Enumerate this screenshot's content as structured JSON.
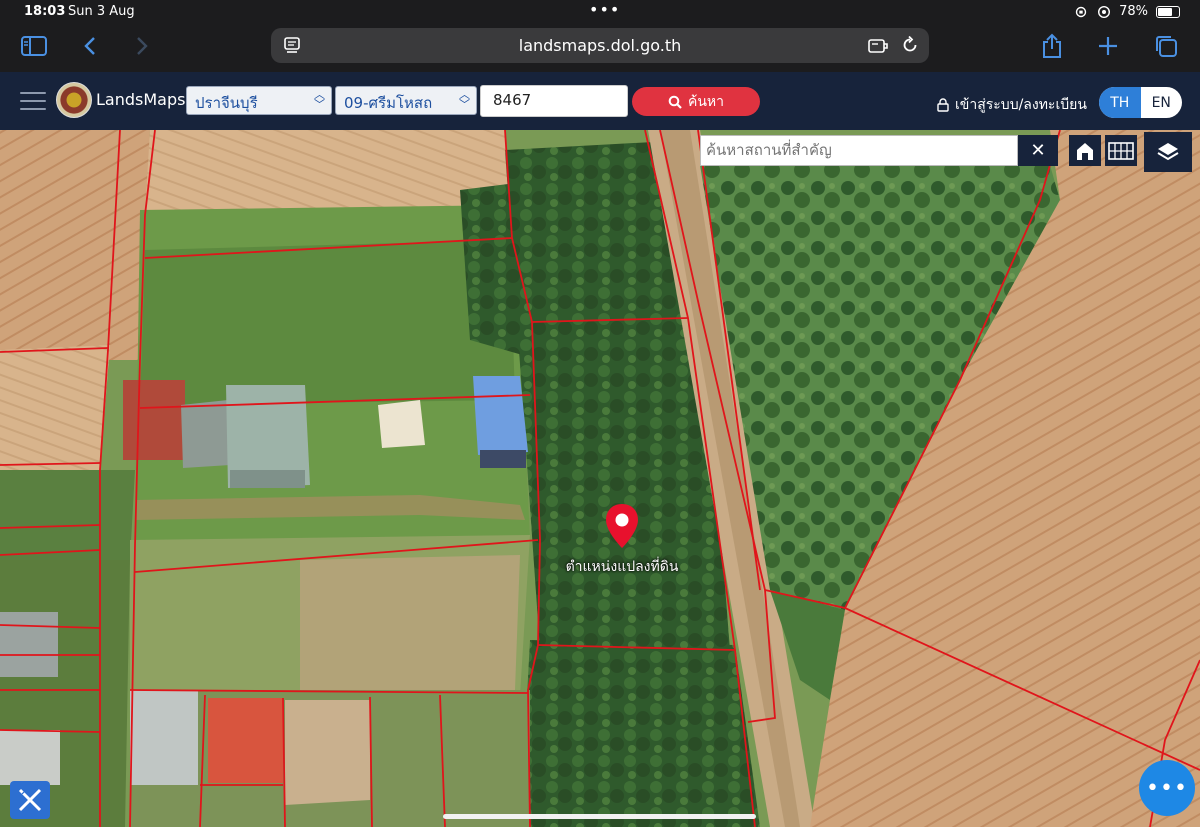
{
  "status_bar": {
    "time": "18:03",
    "date": "Sun 3 Aug",
    "battery": "78%",
    "battery_level": 0.78
  },
  "browser": {
    "url": "landsmaps.dol.go.th"
  },
  "app": {
    "brand": "LandsMaps",
    "province_select": "ปราจีนบุรี",
    "district_select": "09-ศรีมโหสถ",
    "parcel_number": "8467",
    "search_label": "ค้นหา",
    "login_label": "เข้าสู่ระบบ/ลงทะเบียน",
    "lang_th": "TH",
    "lang_en": "EN",
    "active_lang": "TH"
  },
  "map": {
    "place_search_placeholder": "ค้นหาสถานที่สำคัญ",
    "pin_label": "ตำแหน่งแปลงที่ดิน",
    "pin_color": "#e8112d",
    "parcel_line_color": "#e0151b"
  },
  "colors": {
    "accent": "#2e7fd8",
    "search": "#e03340",
    "header": "#17233b"
  }
}
